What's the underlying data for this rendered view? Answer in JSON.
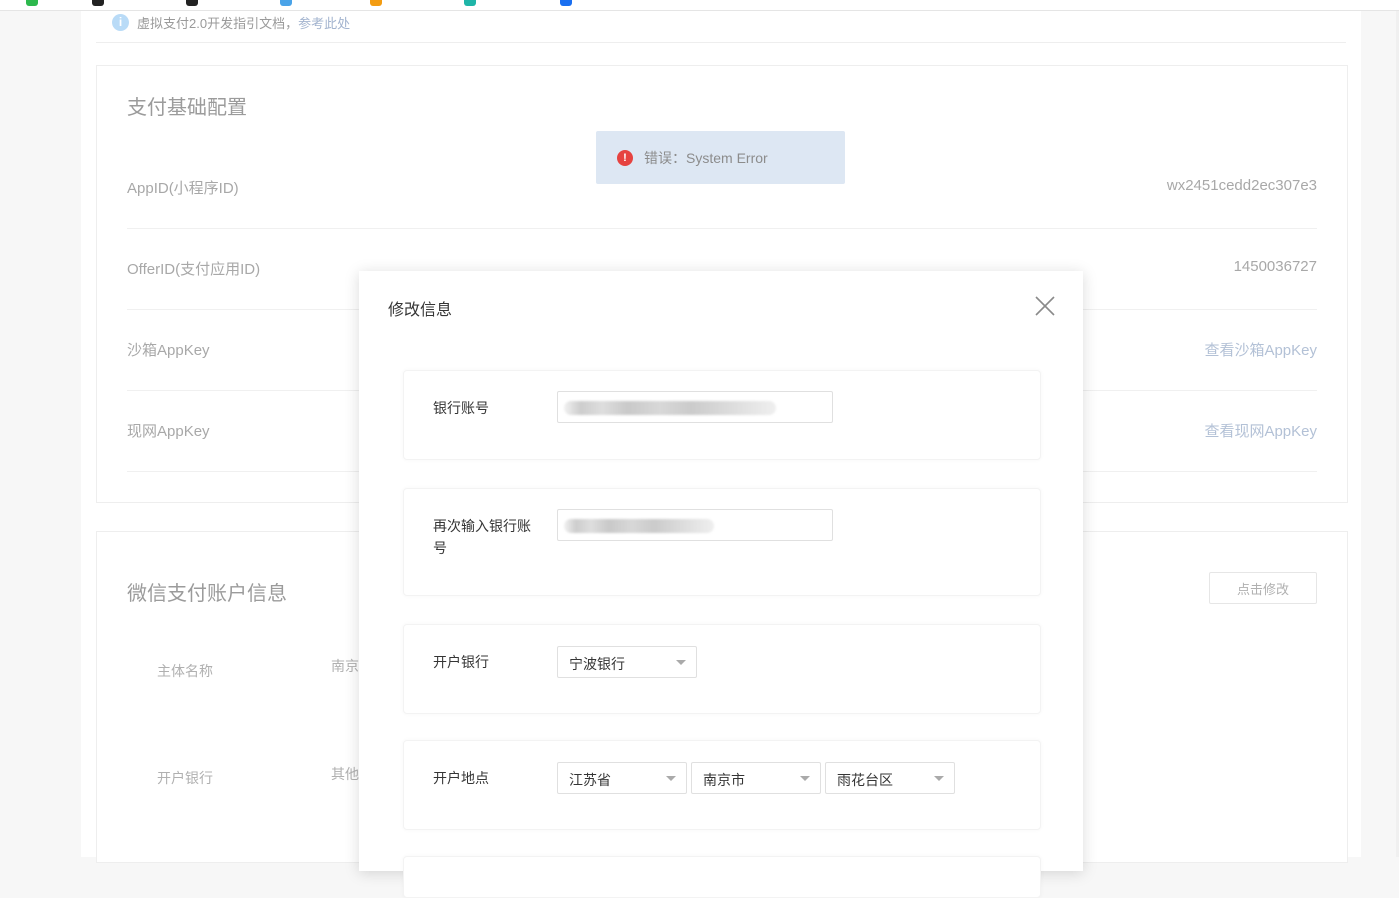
{
  "notice": {
    "text": "虚拟支付2.0开发指引文档，",
    "link": "参考此处"
  },
  "basic_config": {
    "title": "支付基础配置",
    "rows": [
      {
        "label": "AppID(小程序ID)",
        "value": "wx2451cedd2ec307e3"
      },
      {
        "label": "OfferID(支付应用ID)",
        "value": "1450036727"
      },
      {
        "label": "沙箱AppKey",
        "value": "查看沙箱AppKey"
      },
      {
        "label": "现网AppKey",
        "value": "查看现网AppKey"
      }
    ]
  },
  "toast": {
    "text": "错误：System Error"
  },
  "wechat_account": {
    "title": "微信支付账户信息",
    "edit_label": "点击修改",
    "rows": [
      {
        "label": "主体名称",
        "value": "南京"
      },
      {
        "label": "开户银行",
        "value": "其他"
      }
    ]
  },
  "modal": {
    "title": "修改信息",
    "fields": {
      "account_label": "银行账号",
      "account_confirm_label": "再次输入银行账号",
      "bank_label": "开户银行",
      "bank_value": "宁波银行",
      "location_label": "开户地点",
      "province": "江苏省",
      "city": "南京市",
      "district": "雨花台区"
    }
  },
  "colors": {
    "error": "#e64340",
    "toast_bg": "#dde7f3",
    "link": "#a3b4cf"
  }
}
